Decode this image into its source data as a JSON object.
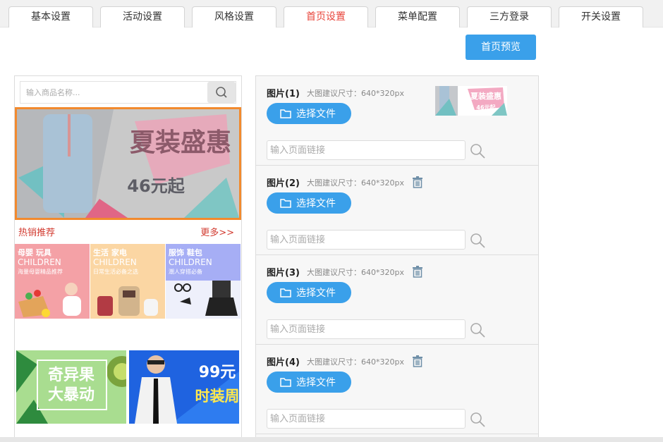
{
  "tabs": [
    "基本设置",
    "活动设置",
    "风格设置",
    "首页设置",
    "菜单配置",
    "三方登录",
    "开关设置"
  ],
  "active_tab": "首页设置",
  "preview_button": "首页预览",
  "phone": {
    "search_placeholder": "输入商品名称...",
    "banner": {
      "title": "夏装盛惠",
      "subtitle": "46元起"
    },
    "hot_label": "热销推荐",
    "more_label": "更多>>",
    "categories": [
      {
        "line1": "母婴 玩具",
        "line2": "CHILDREN",
        "line3": "海量母婴精品推荐"
      },
      {
        "line1": "生活 家电",
        "line2": "CHILDREN",
        "line3": "日常生活必备之选"
      },
      {
        "line1": "服饰 鞋包",
        "line2": "CHILDREN",
        "line3": "潮人穿搭必备"
      }
    ],
    "promos": [
      {
        "line1": "奇异果",
        "line2": "大暴动"
      },
      {
        "line1": "99元",
        "line2": "时装周"
      }
    ]
  },
  "slots": [
    {
      "title": "图片(1)",
      "hint": "大图建议尺寸：640*320px",
      "button": "选择文件",
      "link_placeholder": "输入页面链接",
      "has_thumb": true
    },
    {
      "title": "图片(2)",
      "hint": "大图建议尺寸：640*320px",
      "button": "选择文件",
      "link_placeholder": "输入页面链接",
      "has_thumb": false
    },
    {
      "title": "图片(3)",
      "hint": "大图建议尺寸：640*320px",
      "button": "选择文件",
      "link_placeholder": "输入页面链接",
      "has_thumb": false
    },
    {
      "title": "图片(4)",
      "hint": "大图建议尺寸：640*320px",
      "button": "选择文件",
      "link_placeholder": "输入页面链接",
      "has_thumb": false
    }
  ],
  "thumb": {
    "title": "夏装盛惠",
    "subtitle": "46元起"
  },
  "colors": {
    "accent": "#3aa0ea",
    "active_tab": "#e8443a",
    "hot": "#d23b30"
  }
}
